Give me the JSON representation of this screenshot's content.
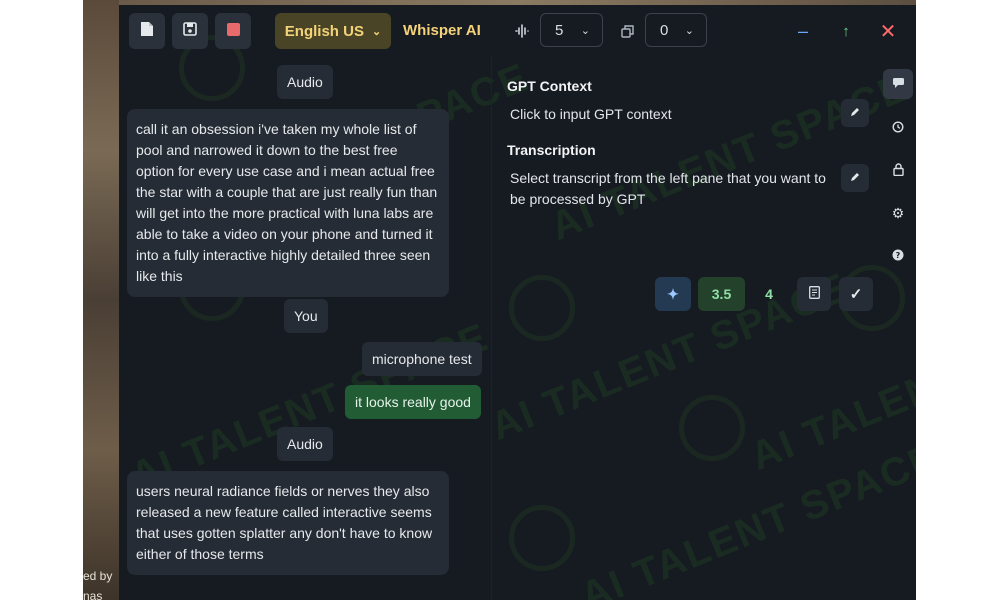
{
  "background": {
    "left_strip_text": "ed by\nnas"
  },
  "toolbar": {
    "new_icon": "file-icon",
    "save_icon": "save-icon",
    "record_icon": "stop-icon",
    "record_color": "#e86a6a",
    "language": "English US",
    "engine": "Whisper AI",
    "audio_icon": "waveform-icon",
    "audio_value": "5",
    "copy_icon": "copy-icon",
    "copy_value": "0",
    "minimize_icon": "minimize-icon",
    "up_icon": "arrow-up-icon",
    "close_icon": "close-icon",
    "accent_color": "#f3d27a"
  },
  "watermark": {
    "text": "AI TALENT SPACE"
  },
  "conversation": {
    "messages": [
      {
        "role": "Audio"
      },
      {
        "text": "call it an obsession i've taken my whole list of pool and narrowed it down to the best free option for every use case and i mean actual free the star with a couple that are just really fun than will get into the more practical with luna labs are able to take a video on your phone and turned it into a fully interactive highly detailed three seen like this"
      },
      {
        "role": "You"
      },
      {
        "text": "microphone test"
      },
      {
        "text": "it looks really good"
      },
      {
        "role": "Audio"
      },
      {
        "text": "users neural radiance fields or nerves they also released a new feature called interactive seems that uses gotten splatter any don't have to know either of those terms"
      }
    ]
  },
  "gpt_panel": {
    "context_title": "GPT Context",
    "context_placeholder": "Click to input GPT context",
    "transcription_title": "Transcription",
    "transcription_text": "Select transcript from the left pane that you want to be processed by GPT",
    "actions": {
      "sparkle_icon": "sparkle-icon",
      "model_a": "3.5",
      "model_b": "4",
      "document_icon": "document-icon",
      "confirm_icon": "check-icon"
    }
  },
  "side_rail": {
    "icons": [
      "chat-icon",
      "history-icon",
      "lock-icon",
      "gear-icon",
      "help-icon"
    ]
  }
}
